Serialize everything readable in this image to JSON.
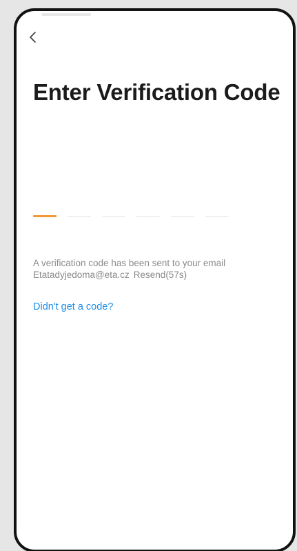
{
  "nav": {
    "back_icon": "chevron-left-icon"
  },
  "screen": {
    "title": "Enter Verification Code"
  },
  "code_input": {
    "length": 6,
    "active_index": 0,
    "accent_color": "#f39a38",
    "inactive_color": "#f0f0f0"
  },
  "hint": {
    "line1": "A verification code has been sent to your email",
    "email": "Etatadyjedoma@eta.cz",
    "resend": "Resend(57s)"
  },
  "help": {
    "link_text": "Didn't get a code?",
    "link_color": "#1f8ee8"
  }
}
